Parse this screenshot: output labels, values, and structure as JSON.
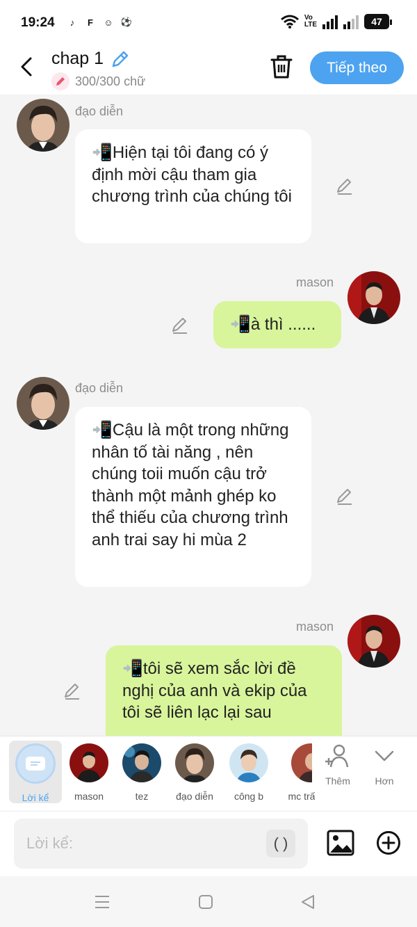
{
  "status_bar": {
    "time": "19:24",
    "network_label_top": "Vo",
    "network_label_bottom": "LTE",
    "battery": "47"
  },
  "header": {
    "title": "chap 1",
    "word_count": "300/300 chữ",
    "next_label": "Tiếp theo"
  },
  "messages": [
    {
      "side": "left",
      "sender": "đạo diễn",
      "text": "📲Hiện tại tôi đang có ý định mời cậu tham gia chương trình của chúng tôi"
    },
    {
      "side": "right",
      "sender": "mason",
      "text": "📲à thì ......"
    },
    {
      "side": "left",
      "sender": "đạo diễn",
      "text": "📲Cậu là một trong những nhân tố tài năng , nên chúng toii muốn cậu trở thành một mảnh ghép ko thể thiếu của chương trình anh trai say hi mùa 2"
    },
    {
      "side": "right",
      "sender": "mason",
      "text": "📲tôi sẽ xem sắc lời đề nghị của anh và ekip của tôi sẽ liên lạc lại sau"
    }
  ],
  "characters": [
    {
      "label": "Lời kể",
      "active": true
    },
    {
      "label": "mason"
    },
    {
      "label": "tez"
    },
    {
      "label": "đạo diễn"
    },
    {
      "label": "công b"
    },
    {
      "label": "mc trấ"
    }
  ],
  "more": {
    "add_label": "Thêm",
    "more_label": "Hơn"
  },
  "input": {
    "placeholder": "Lời kể:",
    "paren_label": "( )"
  },
  "colors": {
    "accent": "#4da3ef",
    "bubble_right": "#d8f59b",
    "bubble_left": "#ffffff",
    "background": "#f4f4f4"
  }
}
